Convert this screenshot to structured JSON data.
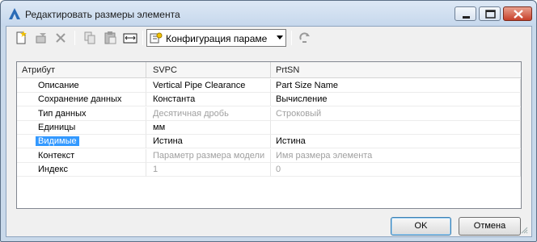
{
  "window": {
    "title": "Редактировать размеры элемента"
  },
  "toolbar": {
    "config_combo": "Конфигурация параме"
  },
  "grid": {
    "columns": [
      "Атрибут",
      "SVPC",
      "PrtSN"
    ],
    "rows": [
      {
        "attr": "Описание",
        "c1": "Vertical Pipe Clearance",
        "c2": "Part Size Name",
        "dim": false
      },
      {
        "attr": "Сохранение данных",
        "c1": "Константа",
        "c2": "Вычисление",
        "dim": false
      },
      {
        "attr": "Тип данных",
        "c1": "Десятичная дробь",
        "c2": "Строковый",
        "dim": true
      },
      {
        "attr": "Единицы",
        "c1": "мм",
        "c2": "",
        "dim": false
      },
      {
        "attr": "Видимые",
        "c1": "Истина",
        "c2": "Истина",
        "dim": false,
        "selected": true
      },
      {
        "attr": "Контекст",
        "c1": "Параметр размера модели",
        "c2": "Имя размера элемента",
        "dim": true
      },
      {
        "attr": "Индекс",
        "c1": "1",
        "c2": "0",
        "dim": true
      }
    ]
  },
  "buttons": {
    "ok": "OK",
    "cancel": "Отмена"
  }
}
